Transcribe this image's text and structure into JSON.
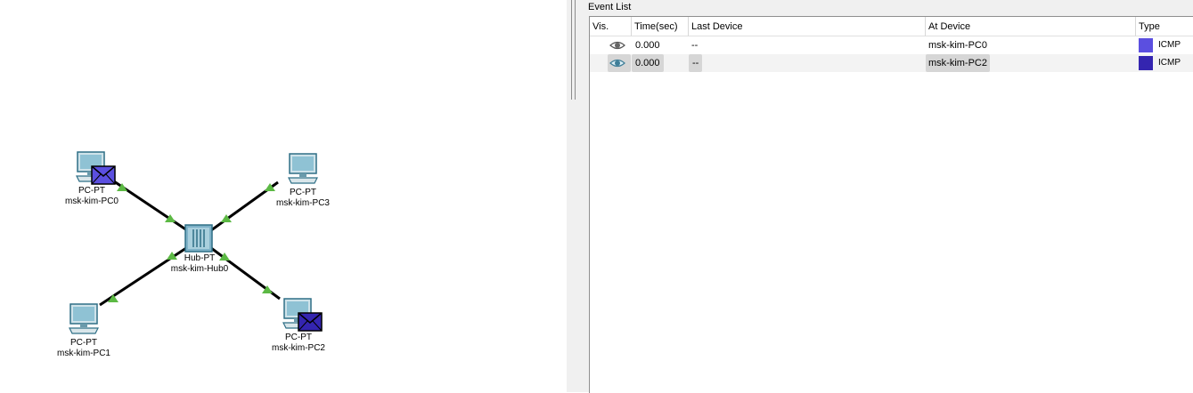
{
  "topology": {
    "devices": [
      {
        "id": "pc0",
        "type": "PC-PT",
        "name": "msk-kim-PC0",
        "has_envelope": true
      },
      {
        "id": "pc3",
        "type": "PC-PT",
        "name": "msk-kim-PC3",
        "has_envelope": false
      },
      {
        "id": "hub0",
        "type": "Hub-PT",
        "name": "msk-kim-Hub0"
      },
      {
        "id": "pc1",
        "type": "PC-PT",
        "name": "msk-kim-PC1",
        "has_envelope": false
      },
      {
        "id": "pc2",
        "type": "PC-PT",
        "name": "msk-kim-PC2",
        "has_envelope": true
      }
    ],
    "link_color": "#000000",
    "port_up_color": "#5cb944"
  },
  "event_list": {
    "title": "Event List",
    "columns": {
      "vis": "Vis.",
      "time": "Time(sec)",
      "last_device": "Last Device",
      "at_device": "At Device",
      "type": "Type"
    },
    "rows": [
      {
        "time": "0.000",
        "last_device": "--",
        "at_device": "msk-kim-PC0",
        "type": "ICMP",
        "color": "#5b4fe0",
        "selected": false
      },
      {
        "time": "0.000",
        "last_device": "--",
        "at_device": "msk-kim-PC2",
        "type": "ICMP",
        "color": "#3425b0",
        "selected": true
      }
    ]
  }
}
